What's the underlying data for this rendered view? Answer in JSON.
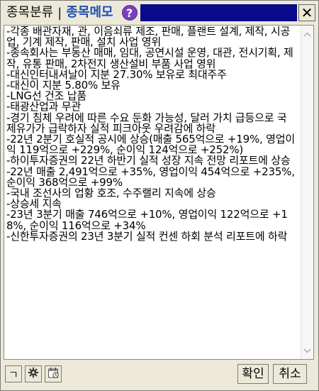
{
  "titlebar": {
    "tab_category": "종목분류",
    "tab_separator": "|",
    "tab_memo": "종목메모",
    "help_glyph": "?",
    "close_glyph": "✕"
  },
  "memo": {
    "lines": [
      "-각종 배관자재, 관, 이음쇠류 제조, 판매, 플랜트 설계, 제작, 시공업, 기계 제작, 판매, 설치 사업 영위",
      "-종속회사는 부동산 매매, 임대, 공연시설 운영, 대관, 전시기획, 제작, 유통 판매, 2차전지 생산설비 부품 사업 영위",
      "-대신인터내셔날이 지분 27.30% 보유로 최대주주",
      "-대신이 지분 5.80% 보유",
      "-LNG선 건조 납품",
      "-태광산업과 무관",
      "-경기 침체 우려에 따른 수요 둔화 가능성, 달러 가치 급등으로 국제유가가 급락하자 실적 피크아웃 우려감에 하락",
      "-22년 2분기 호실적 공시에 상승(매출 565억으로 +19%, 영업이익 119억으로 +229%, 순이익 124억으로 +252%)",
      "-하이투자증권의 22년 하반기 실적 성장 지속 전망 리포트에 상승",
      "-22년 매출 2,491억으로 +35%, 영업이익 454억으로 +235%, 순이익 368억으로 +99%",
      "-국내 조선사의 업황 호조, 수주랠리 지속에 상승",
      "-상승세 지속",
      "-23년 3분기 매출 746억으로 +10%, 영업이익 122억으로 +18%, 순이익 116억으로 +34%",
      "-신한투자증권의 23년 3분기 실적 컨센 하회 분석 리포트에 하락"
    ]
  },
  "toolbar": {
    "font_glyph": "ㄱ",
    "settings_icon": "gear-icon",
    "calendar_icon": "calendar-icon",
    "ok_label": "확인",
    "cancel_label": "취소"
  }
}
